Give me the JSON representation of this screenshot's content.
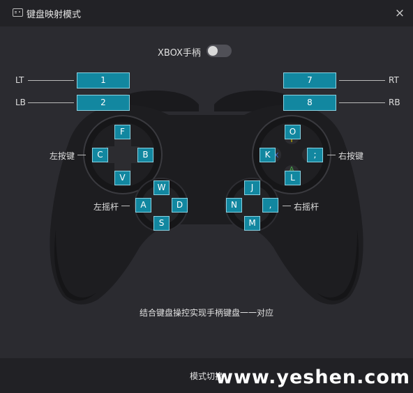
{
  "window": {
    "title": "键盘映射模式",
    "close_label": "×"
  },
  "xbox": {
    "label": "XBOX手柄",
    "enabled": false
  },
  "triggers": {
    "lt": {
      "label": "LT",
      "key": "1"
    },
    "lb": {
      "label": "LB",
      "key": "2"
    },
    "rt": {
      "label": "RT",
      "key": "7"
    },
    "rb": {
      "label": "RB",
      "key": "8"
    }
  },
  "dpad": {
    "label": "左按键",
    "up": "F",
    "left": "C",
    "right": "B",
    "down": "V"
  },
  "buttons": {
    "label": "右按键",
    "top": "O",
    "left": "K",
    "right": ";",
    "bottom": "L"
  },
  "left_stick": {
    "label": "左摇杆",
    "up": "W",
    "left": "A",
    "right": "D",
    "down": "S"
  },
  "right_stick": {
    "label": "右摇杆",
    "up": "J",
    "left": "N",
    "right": ",",
    "down": "M"
  },
  "description": "结合键盘操控实现手柄键盘一一对应",
  "footer": {
    "mode_switch": "模式切换"
  },
  "watermark": "www.yeshen.com",
  "colors": {
    "key_bg": "#1287a0",
    "key_border": "#8ad2e2",
    "pad_body": "#1c1c1f",
    "background": "#2b2b30"
  }
}
